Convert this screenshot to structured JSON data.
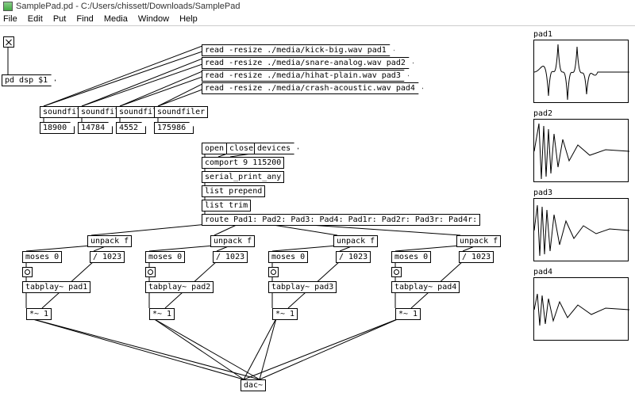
{
  "window": {
    "title": "SamplePad.pd  - C:/Users/chissett/Downloads/SamplePad"
  },
  "menu": {
    "file": "File",
    "edit": "Edit",
    "put": "Put",
    "find": "Find",
    "media": "Media",
    "windows": "Window",
    "help": "Help"
  },
  "dsp": {
    "toggle_label": "pd dsp $1"
  },
  "read": {
    "r1": "read -resize ./media/kick-big.wav pad1",
    "r2": "read -resize ./media/snare-analog.wav pad2",
    "r3": "read -resize ./media/hihat-plain.wav pad3",
    "r4": "read -resize ./media/crash-acoustic.wav pad4"
  },
  "soundfiler": {
    "label": "soundfiler",
    "n1": "18900",
    "n2": "14784",
    "n3": "4552",
    "n4": "175986"
  },
  "comms": {
    "open": "open",
    "close": "close",
    "devices": "devices",
    "comport": "comport 9 115200",
    "serial": "serial_print_any",
    "prepend": "list prepend",
    "trim": "list trim"
  },
  "route": "route Pad1: Pad2: Pad3: Pad4: Pad1r: Pad2r: Pad3r: Pad4r:",
  "chain": {
    "unpack": "unpack f",
    "moses": "moses 0",
    "div": "/ 1023",
    "tabplay1": "tabplay~ pad1",
    "tabplay2": "tabplay~ pad2",
    "tabplay3": "tabplay~ pad3",
    "tabplay4": "tabplay~ pad4",
    "mult": "*~ 1"
  },
  "dac": "dac~",
  "pads": {
    "p1": "pad1",
    "p2": "pad2",
    "p3": "pad3",
    "p4": "pad4"
  }
}
